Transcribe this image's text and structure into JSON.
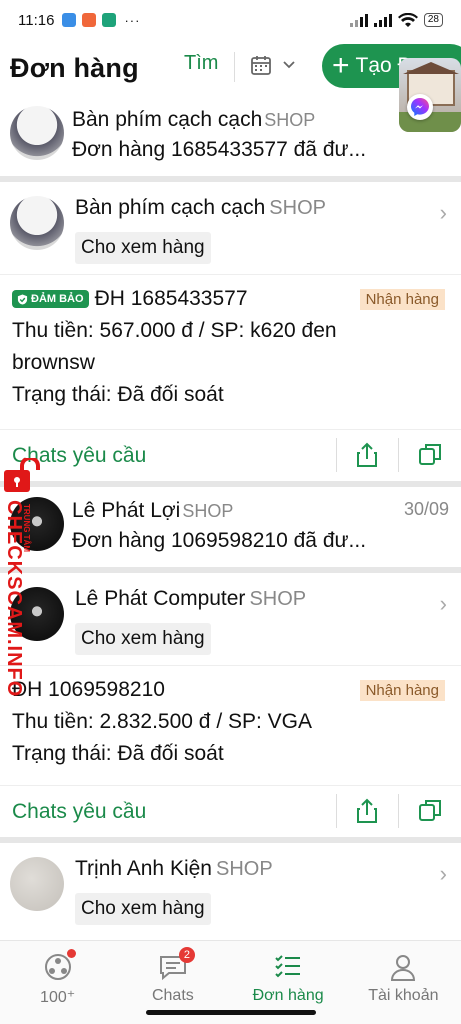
{
  "status_bar": {
    "time": "11:16",
    "dots": "···",
    "battery": "28"
  },
  "header": {
    "title": "Đơn hàng",
    "search_label": "Tìm",
    "create_label": "Tạo Đơn"
  },
  "rows": {
    "conv1": {
      "name": "Bàn phím cạch cạch",
      "shop_tag": "SHOP",
      "preview": "Đơn hàng 1685433577 đã đư..."
    },
    "shop1": {
      "name": "Bàn phím cạch cạch",
      "shop_tag": "SHOP",
      "view_label": "Cho xem hàng"
    },
    "order1": {
      "guarantee": "ĐẢM BẢO",
      "order_id": "ĐH 1685433577",
      "status_badge": "Nhận hàng",
      "line1": "Thu tiền: 567.000 đ / SP: k620 đen",
      "line2": "brownsw",
      "line3": "Trạng thái: Đã đối soát"
    },
    "chats1": {
      "label": "Chats yêu cầu"
    },
    "conv2": {
      "name": "Lê Phát Lợi",
      "shop_tag": "SHOP",
      "date": "30/09",
      "preview": "Đơn hàng 1069598210 đã đư..."
    },
    "shop2": {
      "name": "Lê Phát Computer",
      "shop_tag": "SHOP",
      "view_label": "Cho xem hàng"
    },
    "order2": {
      "order_id": "ĐH 1069598210",
      "status_badge": "Nhận hàng",
      "line1": "Thu tiền: 2.832.500 đ / SP: VGA",
      "line2": "Trạng thái: Đã đối soát"
    },
    "chats2": {
      "label": "Chats yêu cầu"
    },
    "shop3": {
      "name": "Trịnh Anh Kiện",
      "shop_tag": "SHOP",
      "view_label": "Cho xem hàng"
    }
  },
  "watermark": {
    "text": "CHECKSCAM.INFO",
    "small": "TRUNG TÂM"
  },
  "tabs": [
    {
      "label": "100⁺",
      "icon": "community-icon"
    },
    {
      "label": "Chats",
      "icon": "chat-icon",
      "badge": "2"
    },
    {
      "label": "Đơn hàng",
      "icon": "orders-icon"
    },
    {
      "label": "Tài khoản",
      "icon": "account-icon"
    }
  ],
  "colors": {
    "accent": "#1e9450",
    "badge_bg": "#fbe2c8",
    "watermark": "#e01818"
  }
}
